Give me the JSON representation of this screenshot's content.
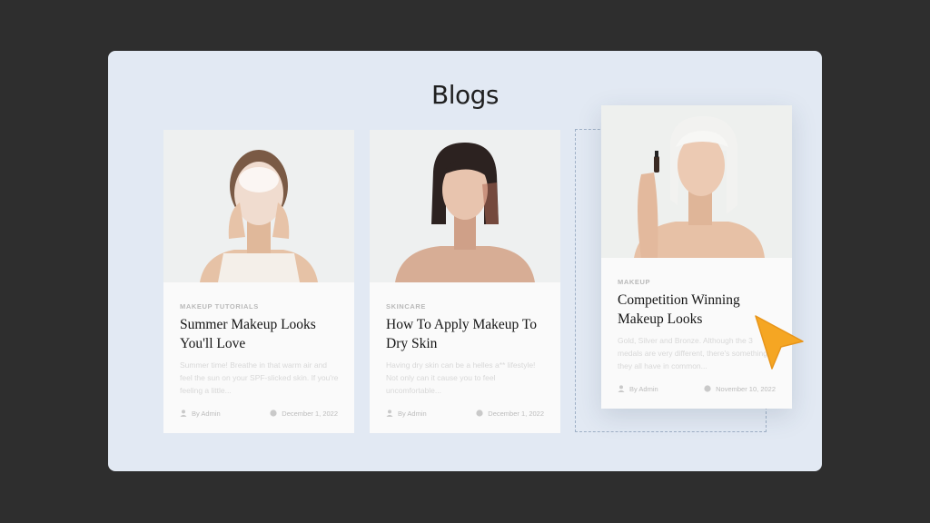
{
  "page": {
    "title": "Blogs"
  },
  "posts": [
    {
      "category": "MAKEUP TUTORIALS",
      "title": "Summer Makeup Looks You'll Love",
      "excerpt": "Summer time! Breathe in that warm air and feel the sun on your SPF-slicked skin. If you're feeling a little...",
      "author": "By Admin",
      "date": "December 1, 2022"
    },
    {
      "category": "SKINCARE",
      "title": "How To Apply Makeup To Dry Skin",
      "excerpt": "Having dry skin can be a helles a** lifestyle! Not only can it cause you to feel uncomfortable...",
      "author": "By Admin",
      "date": "December 1, 2022"
    },
    {
      "category": "MAKEUP",
      "title": "Competition Winning Makeup Looks",
      "excerpt": "Gold, Silver and Bronze. Although the 3 medals are very different, there's something they all have in common...",
      "author": "By Admin",
      "date": "November 10, 2022"
    }
  ],
  "colors": {
    "accent_cursor": "#f5a623",
    "panel": "#e2e9f3",
    "background": "#2e2e2e"
  }
}
